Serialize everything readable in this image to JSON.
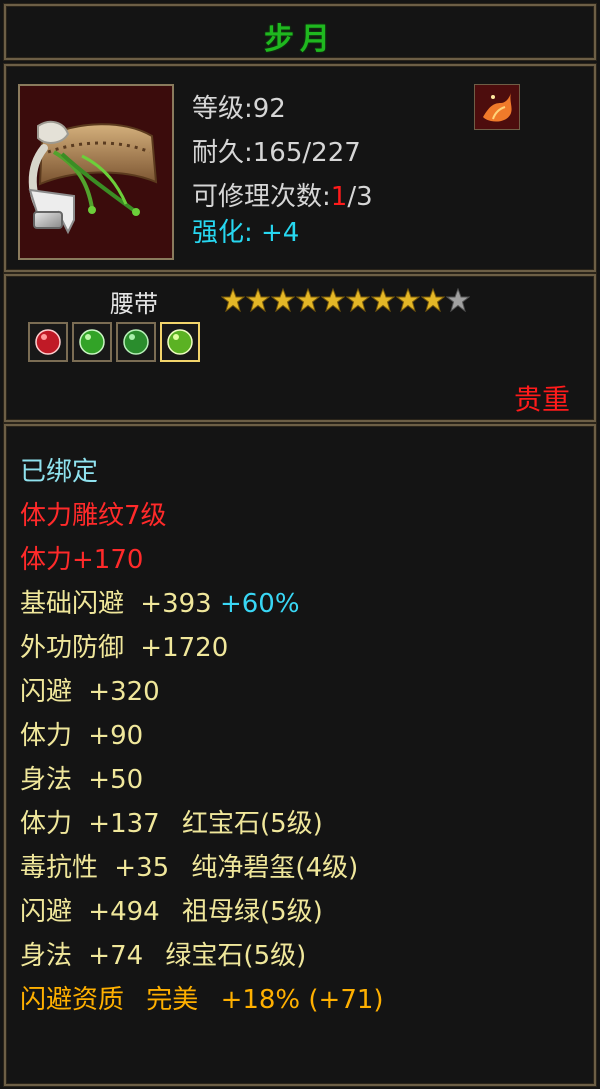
{
  "header": {
    "title": "步月"
  },
  "item": {
    "level_text": "等级:92",
    "durability_text": "耐久:165/227",
    "repair_label": "可修理次数:",
    "repair_used": "1",
    "repair_total": "/3",
    "enhance_text": "强化: +4",
    "type": "腰带",
    "quality": "贵重",
    "stars_filled": 9,
    "stars_total": 10
  },
  "icons": {
    "portrait": "belt-icon",
    "category": "phoenix-icon",
    "star": "star-icon",
    "gem_red": "ruby-gem-icon",
    "gem_green": "emerald-gem-icon",
    "gem_green_2": "jade-gem-icon",
    "gem_yellow_green": "peridot-gem-icon"
  },
  "stats": {
    "bound": "已绑定",
    "engrave": "体力雕纹7级",
    "engrave_bonus": "体力+170",
    "base_dodge_label": "基础闪避",
    "base_dodge_value": "+393",
    "base_dodge_extra": "+60%",
    "external_defense_label": "外功防御",
    "external_defense_value": "+1720",
    "dodge_label": "闪避",
    "dodge_value": "+320",
    "stamina_label": "体力",
    "stamina_value": "+90",
    "agility_label": "身法",
    "agility_value": "+50",
    "gem_stamina_label": "体力",
    "gem_stamina_value": "+137",
    "gem_stamina_name": "红宝石(5级)",
    "poison_label": "毒抗性",
    "poison_value": "+35",
    "poison_gem": "纯净碧玺(4级)",
    "gem_dodge_label": "闪避",
    "gem_dodge_value": "+494",
    "gem_dodge_name": "祖母绿(5级)",
    "gem_agility_label": "身法",
    "gem_agility_value": "+74",
    "gem_agility_name": "绿宝石(5级)",
    "aptitude_label": "闪避资质",
    "aptitude_grade": "完美",
    "aptitude_bonus": "+18% (+71)"
  },
  "colors": {
    "title": "#1fb81f",
    "red": "#ff1b1b",
    "cyan": "#27d7f0",
    "yellow": "#f0e79b",
    "orange": "#ffb000"
  }
}
